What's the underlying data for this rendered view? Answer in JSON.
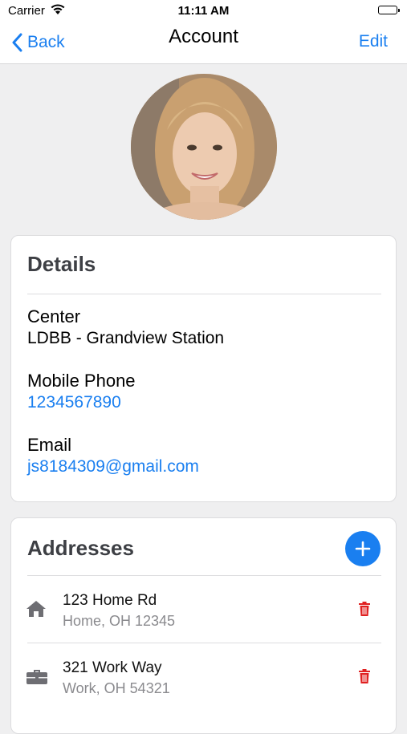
{
  "status_bar": {
    "carrier": "Carrier",
    "time": "11:11 AM"
  },
  "nav": {
    "back_label": "Back",
    "title": "Account",
    "edit_label": "Edit"
  },
  "colors": {
    "accent": "#1a7ff0",
    "delete": "#e02020",
    "heading": "#3d3f44",
    "secondary": "#8a8a8e"
  },
  "details": {
    "heading": "Details",
    "center_label": "Center",
    "center_value": "LDBB - Grandview Station",
    "phone_label": "Mobile Phone",
    "phone_value": "1234567890",
    "email_label": "Email",
    "email_value": "js8184309@gmail.com"
  },
  "addresses": {
    "heading": "Addresses",
    "items": [
      {
        "icon": "home-icon",
        "line1": "123 Home Rd",
        "line2": "Home, OH 12345"
      },
      {
        "icon": "briefcase-icon",
        "line1": "321 Work Way",
        "line2": "Work, OH 54321"
      }
    ]
  }
}
